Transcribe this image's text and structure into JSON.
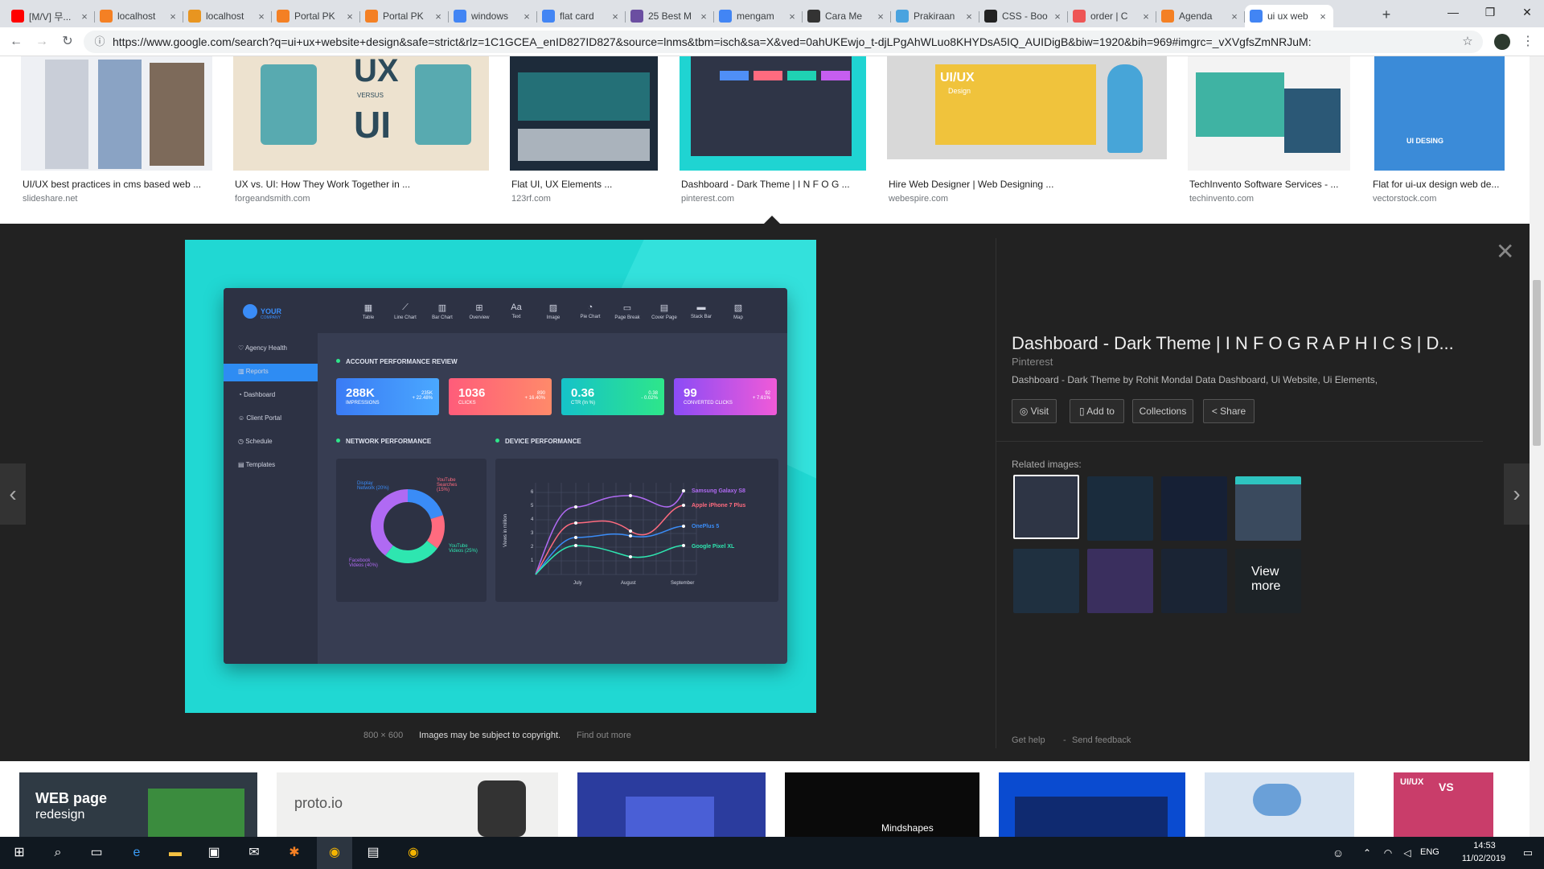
{
  "browser": {
    "tabs": [
      {
        "label": "[M/V] 무...",
        "color": "#ff0000",
        "icon": "youtube-icon"
      },
      {
        "label": "localhost",
        "color": "#f48024",
        "icon": "page-icon"
      },
      {
        "label": "localhost",
        "color": "#e89520",
        "icon": "phpmyadmin-icon"
      },
      {
        "label": "Portal PK",
        "color": "#f48024",
        "icon": "page-icon"
      },
      {
        "label": "Portal PK",
        "color": "#f48024",
        "icon": "page-icon"
      },
      {
        "label": "windows",
        "color": "#4285f4",
        "icon": "google-icon"
      },
      {
        "label": "flat card",
        "color": "#4285f4",
        "icon": "google-icon"
      },
      {
        "label": "25 Best M",
        "color": "#6b4ea1",
        "icon": "page-icon"
      },
      {
        "label": "mengam",
        "color": "#4285f4",
        "icon": "google-icon"
      },
      {
        "label": "Cara Me",
        "color": "#333333",
        "icon": "page-icon"
      },
      {
        "label": "Prakiraan",
        "color": "#4aa3df",
        "icon": "weather-icon"
      },
      {
        "label": "CSS - Boo",
        "color": "#222222",
        "icon": "bootstrap-icon"
      },
      {
        "label": "order | C",
        "color": "#e55",
        "icon": "page-icon"
      },
      {
        "label": "Agenda",
        "color": "#f48024",
        "icon": "page-icon"
      },
      {
        "label": "ui ux web",
        "color": "#4285f4",
        "icon": "google-icon",
        "active": true
      }
    ],
    "new_tab": "+",
    "window_controls": {
      "minimize": "—",
      "restore": "❐",
      "close": "✕"
    },
    "url": "https://www.google.com/search?q=ui+ux+website+design&safe=strict&rlz=1C1GCEA_enID827ID827&source=lnms&tbm=isch&sa=X&ved=0ahUKEwjo_t-djLPgAhWLuo8KHYDsA5IQ_AUIDigB&biw=1920&bih=969#imgrc=_vXVgfsZmNRJuM:"
  },
  "results": [
    {
      "title": "UI/UX best practices in cms based web ...",
      "source": "slideshare.net"
    },
    {
      "title": "UX vs. UI: How They Work Together in ...",
      "source": "forgeandsmith.com"
    },
    {
      "title": "Flat UI, UX Elements ...",
      "source": "123rf.com"
    },
    {
      "title": "Dashboard - Dark Theme | I N F O G ...",
      "source": "pinterest.com"
    },
    {
      "title": "Hire Web Designer | Web Designing ...",
      "source": "webespire.com"
    },
    {
      "title": "TechInvento Software Services - ...",
      "source": "techinvento.com"
    },
    {
      "title": "Flat for ui-ux design web de...",
      "source": "vectorstock.com"
    }
  ],
  "thumb_texts": {
    "ux": "UX",
    "versus": "VERSUS",
    "ui": "UI",
    "uiux": "UI/UX",
    "design": "Design",
    "uidesign": "UI DESING"
  },
  "viewer": {
    "title": "Dashboard - Dark Theme | I N F O G R A P H I C S | D...",
    "site": "Pinterest",
    "description": "Dashboard - Dark Theme by Rohit Mondal Data Dashboard, Ui Website, Ui Elements,",
    "buttons": {
      "visit": "Visit",
      "add_to": "Add to",
      "collections": "Collections",
      "share": "Share"
    },
    "related_label": "Related images:",
    "view_more": "View more",
    "size": "800 × 600",
    "copyright": "Images may be subject to copyright.",
    "find_out_more": "Find out more",
    "get_help": "Get help",
    "send_feedback": "Send feedback"
  },
  "dashboard": {
    "logo_top": "YOUR",
    "logo_bottom": "COMPANY",
    "nav": [
      "Table",
      "Line Chart",
      "Bar Chart",
      "Overview",
      "Text",
      "Image",
      "Pie Chart",
      "Page Break",
      "Cover Page",
      "Stack Bar",
      "Map"
    ],
    "sidebar": [
      "Agency Health",
      "Reports",
      "Dashboard",
      "Client Portal",
      "Schedule",
      "Templates"
    ],
    "section_account": "ACCOUNT PERFORMANCE REVIEW",
    "cards": [
      {
        "value": "288K",
        "label": "IMPRESSIONS",
        "sub1": "235K",
        "sub2": "+ 22.48%",
        "color1": "#3a7bf5",
        "color2": "#4aa8ff"
      },
      {
        "value": "1036",
        "label": "CLICKS",
        "sub1": "890",
        "sub2": "+ 16.40%",
        "color1": "#ff5c7a",
        "color2": "#ff8a6a"
      },
      {
        "value": "0.36",
        "label": "CTR (In %)",
        "sub1": "0.38",
        "sub2": "- 0.02%",
        "color1": "#15c2c9",
        "color2": "#2ee68a"
      },
      {
        "value": "99",
        "label": "CONVERTED CLICKS",
        "sub1": "92",
        "sub2": "+ 7.61%",
        "color1": "#8b4cf6",
        "color2": "#f05ad8"
      }
    ],
    "section_network": "NETWORK PERFORMANCE",
    "section_device": "DEVICE PERFORMANCE",
    "donut_labels": {
      "display": "Display Network (20%)",
      "youtube_search": "YouTube Searches (15%)",
      "youtube_videos": "YouTube Videos (25%)",
      "facebook": "Facebook Videos (40%)"
    },
    "device_legend": [
      "Samsung Galaxy S8",
      "Apple iPhone 7 Plus",
      "OnePlus 5",
      "Google Pixel XL"
    ],
    "device_ylabel": "Views in million",
    "device_months": [
      "July",
      "August",
      "September"
    ],
    "device_yticks": [
      "6",
      "5",
      "4",
      "3",
      "2",
      "1"
    ]
  },
  "bottom_row": {
    "web_page": "WEB page",
    "redesign": "redesign",
    "proto": "proto.io",
    "mindshapes": "Mindshapes",
    "uiux": "UI/UX",
    "vs": "VS"
  },
  "taskbar": {
    "time": "14:53",
    "date": "11/02/2019",
    "lang": "ENG"
  }
}
